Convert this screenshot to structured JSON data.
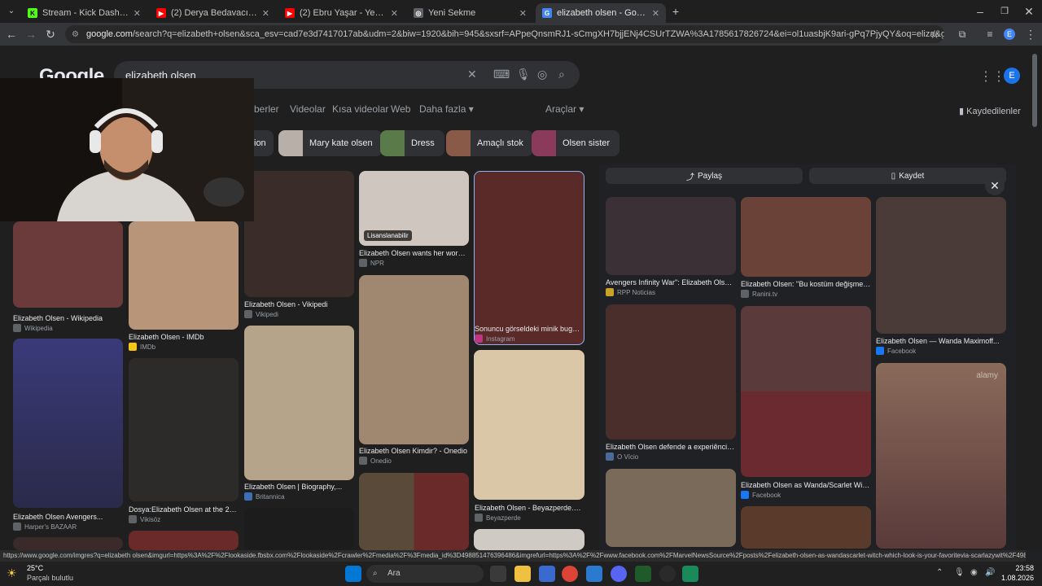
{
  "tabs": [
    {
      "title": "Stream - Kick Dashboard",
      "fav": "K",
      "color": "#53fc18"
    },
    {
      "title": "(2) Derya Bedavacı - Atlatırım -",
      "fav": "▶",
      "color": "#ff0000"
    },
    {
      "title": "(2) Ebru Yaşar - Yeminim Var (O",
      "fav": "▶",
      "color": "#ff0000"
    },
    {
      "title": "Yeni Sekme",
      "fav": "◎",
      "color": "#5f6368"
    },
    {
      "title": "elizabeth olsen - Google'da Ara",
      "fav": "G",
      "color": "#4285f4"
    }
  ],
  "address": {
    "host": "google.com",
    "path": "/search?q=elizabeth+olsen&sca_esv=cad7e3d7417017ab&udm=2&biw=1920&bih=945&sxsrf=APpeQnsmRJ1-sCmgXH7bjjENj4CSUrTZWA%3A1785617826724&ei=ol1uasbjK9ari-gPq7PjyQY&oq=eliza&gs_lp=Egtnd3Mtd2l6LWltZylFZW..."
  },
  "google": {
    "logo": "Google",
    "query": "elizabeth olsen",
    "nav": [
      "berler",
      "Videolar",
      "Kısa videolar",
      "Web",
      "Daha fazla",
      "Araçlar"
    ],
    "saved": "Kaydedilenler",
    "account_initial": "E",
    "chips": [
      "ion",
      "Mary kate olsen",
      "Dress",
      "Amaçlı stok",
      "Olsen sister"
    ]
  },
  "grid": [
    {
      "caption": "Elizabeth Olsen - Wikipedia",
      "source": "Wikipedia",
      "color": "#6b3a3a"
    },
    {
      "caption": "Elizabeth Olsen - IMDb",
      "source": "IMDb",
      "color": "#b89478"
    },
    {
      "caption": "Elizabeth Olsen - Vikipedi",
      "source": "Vikipedi",
      "color": "#3a2c28"
    },
    {
      "caption": "Elizabeth Olsen wants her work t...",
      "source": "NPR",
      "badge": "Lisanslanabilir",
      "color": "#cfc6bf"
    },
    {
      "caption": "Sonuncu görseldeki minik bugün...",
      "source": "Instagram",
      "color": "#5a2a28"
    },
    {
      "caption": "Elizabeth Olsen Avengers...",
      "source": "Harper's BAZAAR",
      "color": "#4a4a7a"
    },
    {
      "caption": "Dosya:Elizabeth Olsen at the 202...",
      "source": "Vikisöz",
      "color": "#2d2b2a"
    },
    {
      "caption": "Elizabeth Olsen | Biography,...",
      "source": "Britannica",
      "color": "#b6a48a"
    },
    {
      "caption": "Elizabeth Olsen Kimdir? - Onedio",
      "source": "Onedio",
      "color": "#a08870"
    },
    {
      "caption": "Elizabeth Olsen - Beyazperde.com",
      "source": "Beyazperde",
      "color": "#d9c7a8"
    }
  ],
  "panel": {
    "share": "Paylaş",
    "save": "Kaydet",
    "items": [
      {
        "caption": "Avengers Infinity War\": Elizabeth Olsen...",
        "source": "RPP Noticias",
        "color": "#3a3036"
      },
      {
        "caption": "Elizabeth Olsen: \"Bu kostüm değişmeli!...",
        "source": "Ranini.tv",
        "color": "#6a4238"
      },
      {
        "caption": "Elizabeth Olsen — Wanda Maximoff...",
        "source": "Facebook",
        "color": "#4a3a38"
      },
      {
        "caption": "Elizabeth Olsen defende a experiência...",
        "source": "O Vício",
        "color": "#4a2e2c"
      },
      {
        "caption": "Elizabeth Olsen as Wanda/Scarlet Witc...",
        "source": "Facebook",
        "color": "#5a3a3a"
      },
      {
        "caption": "",
        "source": "",
        "color": "#7a5a4a"
      }
    ],
    "watermark": "alamy"
  },
  "status_url": "https://www.google.com/imgres?q=elizabeth olsen&imgurl=https%3A%2F%2Flookaside.fbsbx.com%2Flookaside%2Fcrawler%2Fmedia%2F%3Fmedia_id%3D498851476396486&imgrefurl=https%3A%2F%2Fwww.facebook.com%2FMarvelNewsSource%2Fposts%2Felizabeth-olsen-as-wandascarlet-witch-which-look-is-your-favoritevia-scarlazywit%2F4988...",
  "taskbar": {
    "weather_temp": "25°C",
    "weather_desc": "Parçalı bulutlu",
    "search": "Ara",
    "time": "23:58",
    "date": "1.08.2026"
  }
}
